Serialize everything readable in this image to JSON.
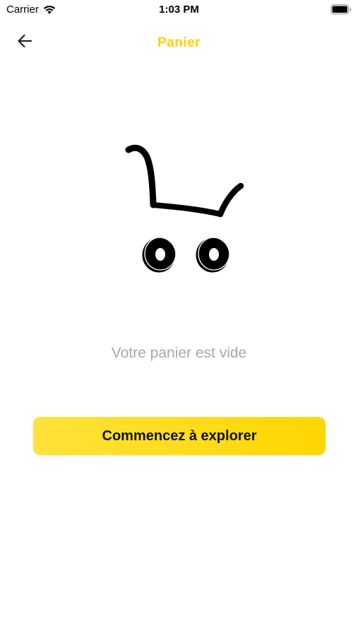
{
  "status_bar": {
    "carrier": "Carrier",
    "time": "1:03 PM",
    "wifi_icon": "wifi-icon",
    "battery_icon": "battery-icon"
  },
  "nav": {
    "title": "Panier",
    "back_icon": "arrow-left-icon"
  },
  "empty_state": {
    "illustration": "shopping-cart-icon",
    "message": "Votre panier est vide"
  },
  "actions": {
    "explore_label": "Commencez à explorer"
  },
  "colors": {
    "accent": "#FFD600",
    "accent_light": "#FFE23A",
    "title": "#FFD000",
    "muted_text": "#A8A8A8"
  }
}
